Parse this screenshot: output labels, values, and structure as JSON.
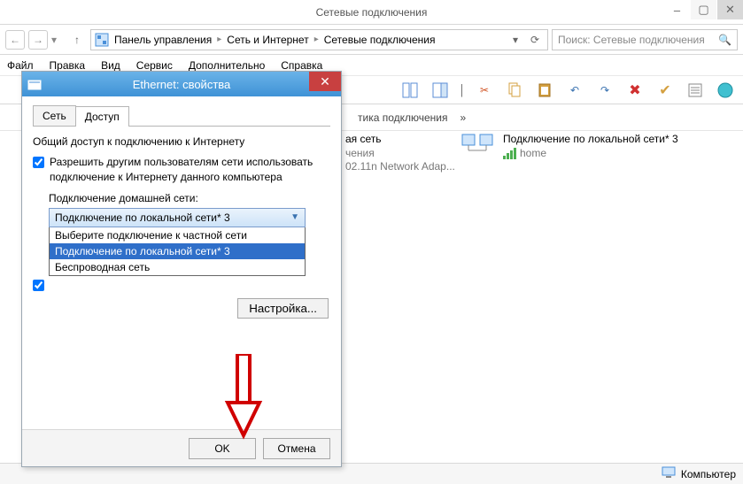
{
  "window": {
    "title": "Сетевые подключения",
    "buttons": {
      "min": "–",
      "max": "▢",
      "close": "✕"
    }
  },
  "nav": {
    "back": "←",
    "forward": "→",
    "dropdown": "▾",
    "up": "↑",
    "refresh": "⟳"
  },
  "breadcrumb": {
    "items": [
      "Панель управления",
      "Сеть и Интернет",
      "Сетевые подключения"
    ]
  },
  "search": {
    "placeholder": "Поиск: Сетевые подключения",
    "icon": "🔍"
  },
  "menubar": [
    "Файл",
    "Правка",
    "Вид",
    "Сервис",
    "Дополнительно",
    "Справка"
  ],
  "toolbar_icons": [
    "layout-icon",
    "preview-icon",
    "divider",
    "cut-icon",
    "copy-icon",
    "paste-icon",
    "undo-icon",
    "redo-icon",
    "delete-icon",
    "check-icon",
    "props-icon",
    "shell-icon"
  ],
  "cmdbar": {
    "label1": "тика подключения",
    "chevrons": "»"
  },
  "connections": [
    {
      "title_partial": "ая сеть",
      "line2": "чения",
      "line3": "02.11n Network Adap..."
    },
    {
      "title": "Подключение по локальной сети* 3",
      "line2": "home"
    }
  ],
  "statusbar": {
    "right_label": "Компьютер"
  },
  "dialog": {
    "title": "Ethernet: свойства",
    "close": "✕",
    "tabs": {
      "t1": "Сеть",
      "t2": "Доступ"
    },
    "group_title": "Общий доступ к подключению к Интернету",
    "check1": "Разрешить другим пользователям сети использовать подключение к Интернету данного компьютера",
    "sel_label": "Подключение домашней сети:",
    "selected": "Подключение по локальной сети* 3",
    "options": [
      "Выберите подключение к частной сети",
      "Подключение по локальной сети* 3",
      "Беспроводная сеть"
    ],
    "settings_btn": "Настройка...",
    "ok": "OK",
    "cancel": "Отмена"
  }
}
